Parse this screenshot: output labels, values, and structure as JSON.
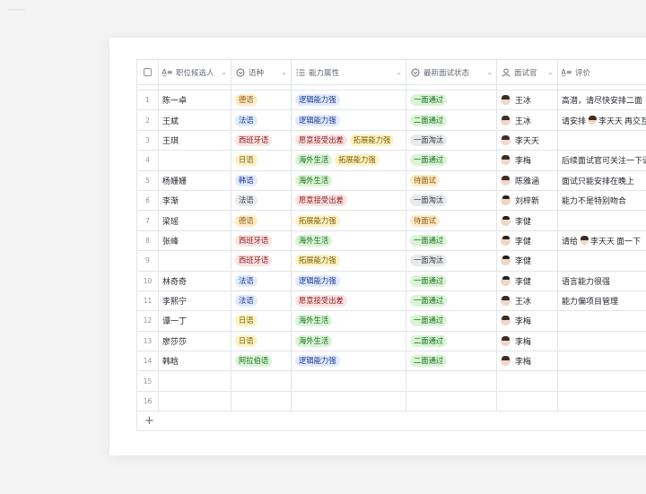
{
  "columns": {
    "name": "职位候选人",
    "lang": "语种",
    "ability": "能力属性",
    "status": "最新面试状态",
    "interviewer": "面试官",
    "eval": "评价"
  },
  "header_icons": {
    "name": "text-icon",
    "lang": "single-select-icon",
    "ability": "multi-select-icon",
    "status": "single-select-icon",
    "interviewer": "person-icon",
    "eval": "text-icon"
  },
  "tag_colors": {
    "orange": {
      "bg": "#fdebc8",
      "fg": "#8f5a0b"
    },
    "blue": {
      "bg": "#e1eaff",
      "fg": "#1d3a8a"
    },
    "red": {
      "bg": "#fbe3e3",
      "fg": "#8a1d1d"
    },
    "yellow": {
      "bg": "#fdf2c4",
      "fg": "#7a5c00"
    },
    "green": {
      "bg": "#d9f5d6",
      "fg": "#1d6b1d"
    },
    "gray": {
      "bg": "#e9eaec",
      "fg": "#3a3f47"
    }
  },
  "rows": [
    {
      "idx": "1",
      "name": "陈一卓",
      "lang": {
        "text": "德语",
        "color": "orange"
      },
      "ability": [
        {
          "text": "逻辑能力强",
          "color": "blue"
        }
      ],
      "status": {
        "text": "一面通过",
        "color": "green"
      },
      "interviewer": {
        "name": "王冰",
        "gender": "female"
      },
      "eval": {
        "pre": "高潜，请尽快安排二面",
        "mention": "",
        "post": ""
      }
    },
    {
      "idx": "2",
      "name": "王斌",
      "lang": {
        "text": "法语",
        "color": "blue"
      },
      "ability": [
        {
          "text": "逻辑能力强",
          "color": "blue"
        }
      ],
      "status": {
        "text": "二面通过",
        "color": "green"
      },
      "interviewer": {
        "name": "王冰",
        "gender": "female"
      },
      "eval": {
        "pre": "请安排",
        "mention": "李天天",
        "post": "再交互"
      }
    },
    {
      "idx": "3",
      "name": "王琪",
      "lang": {
        "text": "西班牙语",
        "color": "red"
      },
      "ability": [
        {
          "text": "愿意接受出差",
          "color": "red"
        },
        {
          "text": "拓展能力强",
          "color": "yellow"
        }
      ],
      "status": {
        "text": "一面淘汰",
        "color": "gray"
      },
      "interviewer": {
        "name": "李天天",
        "gender": "female"
      },
      "eval": {
        "pre": "",
        "mention": "",
        "post": ""
      }
    },
    {
      "idx": "4",
      "name": "",
      "lang": {
        "text": "日语",
        "color": "yellow"
      },
      "ability": [
        {
          "text": "海外生活",
          "color": "green"
        },
        {
          "text": "拓展能力强",
          "color": "yellow"
        }
      ],
      "status": {
        "text": "一面通过",
        "color": "green"
      },
      "interviewer": {
        "name": "李梅",
        "gender": "female"
      },
      "eval": {
        "pre": "后续面试官可关注一下语",
        "mention": "",
        "post": ""
      }
    },
    {
      "idx": "5",
      "name": "杨姗姗",
      "lang": {
        "text": "韩语",
        "color": "blue"
      },
      "ability": [
        {
          "text": "海外生活",
          "color": "green"
        }
      ],
      "status": {
        "text": "待面试",
        "color": "orange"
      },
      "interviewer": {
        "name": "陈雅涵",
        "gender": "female"
      },
      "eval": {
        "pre": "面试只能安排在晚上",
        "mention": "",
        "post": ""
      }
    },
    {
      "idx": "6",
      "name": "李渐",
      "lang": {
        "text": "法语",
        "color": "gray"
      },
      "ability": [
        {
          "text": "愿意接受出差",
          "color": "red"
        }
      ],
      "status": {
        "text": "一面淘汰",
        "color": "gray"
      },
      "interviewer": {
        "name": "刘梓新",
        "gender": "male"
      },
      "eval": {
        "pre": "能力不是特别吻合",
        "mention": "",
        "post": ""
      }
    },
    {
      "idx": "7",
      "name": "梁瑶",
      "lang": {
        "text": "德语",
        "color": "orange"
      },
      "ability": [
        {
          "text": "拓展能力强",
          "color": "yellow"
        }
      ],
      "status": {
        "text": "待面试",
        "color": "orange"
      },
      "interviewer": {
        "name": "李健",
        "gender": "male"
      },
      "eval": {
        "pre": "",
        "mention": "",
        "post": ""
      }
    },
    {
      "idx": "8",
      "name": "张峰",
      "lang": {
        "text": "西班牙语",
        "color": "red"
      },
      "ability": [
        {
          "text": "海外生活",
          "color": "green"
        }
      ],
      "status": {
        "text": "一面通过",
        "color": "green"
      },
      "interviewer": {
        "name": "李健",
        "gender": "male"
      },
      "eval": {
        "pre": "请给",
        "mention": "李天天",
        "post": "面一下"
      }
    },
    {
      "idx": "9",
      "name": "",
      "lang": {
        "text": "西班牙语",
        "color": "red"
      },
      "ability": [
        {
          "text": "拓展能力强",
          "color": "yellow"
        }
      ],
      "status": {
        "text": "一面淘汰",
        "color": "gray"
      },
      "interviewer": {
        "name": "李健",
        "gender": "male"
      },
      "eval": {
        "pre": "",
        "mention": "",
        "post": ""
      }
    },
    {
      "idx": "10",
      "name": "林奇奇",
      "lang": {
        "text": "法语",
        "color": "blue"
      },
      "ability": [
        {
          "text": "逻辑能力强",
          "color": "blue"
        }
      ],
      "status": {
        "text": "一面通过",
        "color": "green"
      },
      "interviewer": {
        "name": "李健",
        "gender": "male"
      },
      "eval": {
        "pre": "语言能力很强",
        "mention": "",
        "post": ""
      }
    },
    {
      "idx": "11",
      "name": "李熙宁",
      "lang": {
        "text": "法语",
        "color": "blue"
      },
      "ability": [
        {
          "text": "愿意接受出差",
          "color": "red"
        }
      ],
      "status": {
        "text": "一面通过",
        "color": "green"
      },
      "interviewer": {
        "name": "王冰",
        "gender": "female"
      },
      "eval": {
        "pre": "能力偏项目管理",
        "mention": "",
        "post": ""
      }
    },
    {
      "idx": "12",
      "name": "谭一丁",
      "lang": {
        "text": "日语",
        "color": "yellow"
      },
      "ability": [
        {
          "text": "海外生活",
          "color": "green"
        }
      ],
      "status": {
        "text": "一面通过",
        "color": "green"
      },
      "interviewer": {
        "name": "李梅",
        "gender": "female"
      },
      "eval": {
        "pre": "",
        "mention": "",
        "post": ""
      }
    },
    {
      "idx": "13",
      "name": "廖莎莎",
      "lang": {
        "text": "日语",
        "color": "yellow"
      },
      "ability": [
        {
          "text": "海外生活",
          "color": "green"
        }
      ],
      "status": {
        "text": "二面通过",
        "color": "green"
      },
      "interviewer": {
        "name": "李梅",
        "gender": "female"
      },
      "eval": {
        "pre": "",
        "mention": "",
        "post": ""
      }
    },
    {
      "idx": "14",
      "name": "韩晗",
      "lang": {
        "text": "阿拉伯语",
        "color": "green"
      },
      "ability": [
        {
          "text": "逻辑能力强",
          "color": "blue"
        }
      ],
      "status": {
        "text": "二面通过",
        "color": "green"
      },
      "interviewer": {
        "name": "李梅",
        "gender": "female"
      },
      "eval": {
        "pre": "",
        "mention": "",
        "post": ""
      }
    },
    {
      "idx": "15",
      "name": "",
      "lang": null,
      "ability": [],
      "status": null,
      "interviewer": null,
      "eval": {
        "pre": "",
        "mention": "",
        "post": ""
      }
    },
    {
      "idx": "16",
      "name": "",
      "lang": null,
      "ability": [],
      "status": null,
      "interviewer": null,
      "eval": {
        "pre": "",
        "mention": "",
        "post": ""
      }
    }
  ],
  "add_row_label": "+"
}
